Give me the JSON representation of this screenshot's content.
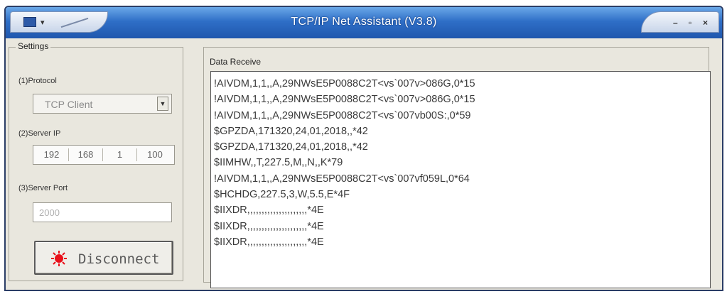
{
  "window": {
    "title": "TCP/IP Net Assistant (V3.8)",
    "colors": {
      "titlebar": "#2f6fc7",
      "face": "#e9e7de",
      "led": "#e8101a"
    }
  },
  "settings": {
    "legend": "Settings",
    "protocol_label": "(1)Protocol",
    "protocol_value": "TCP Client",
    "server_ip_label": "(2)Server IP",
    "server_ip": [
      "192",
      "168",
      "1",
      "100"
    ],
    "server_port_label": "(3)Server Port",
    "server_port": "2000",
    "disconnect_label": "Disconnect"
  },
  "data_receive": {
    "legend": "Data Receive",
    "lines": [
      "!AIVDM,1,1,,A,29NWsE5P0088C2T<vs`007v>086G,0*15",
      "!AIVDM,1,1,,A,29NWsE5P0088C2T<vs`007v>086G,0*15",
      "!AIVDM,1,1,,A,29NWsE5P0088C2T<vs`007vb00S:,0*59",
      "$GPZDA,171320,24,01,2018,,*42",
      "$GPZDA,171320,24,01,2018,,*42",
      "$IIMHW,,T,227.5,M,,N,,K*79",
      "!AIVDM,1,1,,A,29NWsE5P0088C2T<vs`007vf059L,0*64",
      "$HCHDG,227.5,3,W,5.5,E*4F",
      "$IIXDR,,,,,,,,,,,,,,,,,,,,,*4E",
      "$IIXDR,,,,,,,,,,,,,,,,,,,,,*4E",
      "$IIXDR,,,,,,,,,,,,,,,,,,,,,*4E"
    ]
  }
}
